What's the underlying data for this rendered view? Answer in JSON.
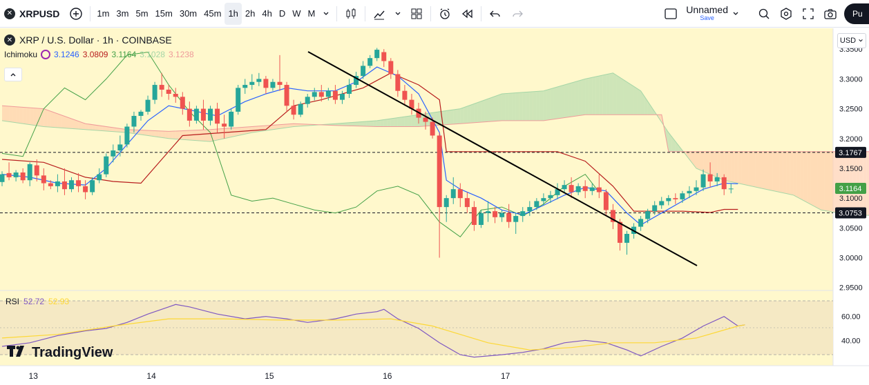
{
  "toolbar": {
    "symbol": "XRPUSD",
    "add_symbol_icon": "plus-circle-icon",
    "timeframes": [
      "1m",
      "3m",
      "5m",
      "15m",
      "30m",
      "45m",
      "1h",
      "2h",
      "4h",
      "D",
      "W",
      "M"
    ],
    "active_timeframe": "1h",
    "layout_name": "Unnamed",
    "save_label": "Save",
    "user_initial": "Pu"
  },
  "legend": {
    "symbol_title": "XRP / U.S. Dollar · 1h · COINBASE",
    "indicator": "Ichimoku",
    "ichimoku_values": [
      {
        "value": "3.1246",
        "color": "#2962ff"
      },
      {
        "value": "3.0809",
        "color": "#b71c1c"
      },
      {
        "value": "3.1164",
        "color": "#43a047"
      },
      {
        "value": "3.1028",
        "color": "#a5d6a7"
      },
      {
        "value": "3.1238",
        "color": "#ef9a9a"
      }
    ],
    "currency": "USD"
  },
  "rsi": {
    "label": "RSI",
    "value": "52.72",
    "ma_value": "52.93",
    "levels": [
      {
        "label": "60.00",
        "value": 60
      },
      {
        "label": "40.00",
        "value": 40
      }
    ]
  },
  "branding": {
    "name": "TradingView"
  },
  "chart_data": {
    "type": "candlestick",
    "title": "XRP / U.S. Dollar · 1h · COINBASE",
    "ylim": [
      2.945,
      3.385
    ],
    "y_ticks": [
      "3.3500",
      "3.3000",
      "3.2500",
      "3.2000",
      "3.1500",
      "3.1000",
      "3.0500",
      "3.0000",
      "2.9500"
    ],
    "x_ticks": [
      {
        "label": "13",
        "t": 4.5
      },
      {
        "label": "14",
        "t": 21.5
      },
      {
        "label": "15",
        "t": 38.5
      },
      {
        "label": "16",
        "t": 55.5
      },
      {
        "label": "17",
        "t": 72.5
      }
    ],
    "price_labels": [
      {
        "label": "3.1767",
        "value": 3.1767,
        "bg": "#131722",
        "dashed": true
      },
      {
        "label": "3.1164",
        "value": 3.1164,
        "bg": "#43a047",
        "dashed": false
      },
      {
        "label": "3.0753",
        "value": 3.0753,
        "bg": "#131722",
        "dashed": true
      }
    ],
    "candles": [
      [
        3.127,
        3.145,
        3.14,
        3.12
      ],
      [
        3.142,
        3.16,
        3.135,
        3.13
      ],
      [
        3.135,
        3.147,
        3.143,
        3.128
      ],
      [
        3.143,
        3.15,
        3.13,
        3.125
      ],
      [
        3.13,
        3.16,
        3.157,
        3.12
      ],
      [
        3.155,
        3.165,
        3.138,
        3.128
      ],
      [
        3.138,
        3.15,
        3.125,
        3.113
      ],
      [
        3.125,
        3.13,
        3.12,
        3.115
      ],
      [
        3.12,
        3.14,
        3.128,
        3.11
      ],
      [
        3.128,
        3.15,
        3.115,
        3.105
      ],
      [
        3.115,
        3.135,
        3.13,
        3.11
      ],
      [
        3.13,
        3.142,
        3.12,
        3.11
      ],
      [
        3.12,
        3.13,
        3.11,
        3.098
      ],
      [
        3.11,
        3.135,
        3.13,
        3.105
      ],
      [
        3.13,
        3.15,
        3.14,
        3.125
      ],
      [
        3.14,
        3.175,
        3.17,
        3.135
      ],
      [
        3.17,
        3.19,
        3.18,
        3.16
      ],
      [
        3.18,
        3.205,
        3.19,
        3.17
      ],
      [
        3.19,
        3.225,
        3.22,
        3.185
      ],
      [
        3.22,
        3.245,
        3.238,
        3.21
      ],
      [
        3.238,
        3.248,
        3.245,
        3.23
      ],
      [
        3.245,
        3.272,
        3.265,
        3.24
      ],
      [
        3.265,
        3.295,
        3.29,
        3.258
      ],
      [
        3.29,
        3.31,
        3.282,
        3.27
      ],
      [
        3.282,
        3.29,
        3.275,
        3.265
      ],
      [
        3.275,
        3.285,
        3.27,
        3.26
      ],
      [
        3.27,
        3.278,
        3.25,
        3.24
      ],
      [
        3.25,
        3.262,
        3.23,
        3.22
      ],
      [
        3.23,
        3.255,
        3.25,
        3.225
      ],
      [
        3.25,
        3.265,
        3.23,
        3.215
      ],
      [
        3.23,
        3.255,
        3.25,
        3.222
      ],
      [
        3.25,
        3.26,
        3.225,
        3.21
      ],
      [
        3.225,
        3.24,
        3.22,
        3.2
      ],
      [
        3.22,
        3.25,
        3.245,
        3.215
      ],
      [
        3.245,
        3.29,
        3.285,
        3.24
      ],
      [
        3.285,
        3.3,
        3.29,
        3.275
      ],
      [
        3.29,
        3.308,
        3.295,
        3.282
      ],
      [
        3.295,
        3.31,
        3.3,
        3.288
      ],
      [
        3.3,
        3.305,
        3.285,
        3.275
      ],
      [
        3.285,
        3.3,
        3.295,
        3.28
      ],
      [
        3.295,
        3.34,
        3.29,
        3.28
      ],
      [
        3.29,
        3.295,
        3.255,
        3.245
      ],
      [
        3.255,
        3.265,
        3.24,
        3.232
      ],
      [
        3.24,
        3.262,
        3.258,
        3.236
      ],
      [
        3.258,
        3.275,
        3.27,
        3.252
      ],
      [
        3.27,
        3.285,
        3.278,
        3.264
      ],
      [
        3.278,
        3.29,
        3.27,
        3.262
      ],
      [
        3.27,
        3.285,
        3.28,
        3.264
      ],
      [
        3.28,
        3.29,
        3.265,
        3.258
      ],
      [
        3.265,
        3.28,
        3.275,
        3.258
      ],
      [
        3.275,
        3.3,
        3.29,
        3.268
      ],
      [
        3.29,
        3.312,
        3.305,
        3.285
      ],
      [
        3.305,
        3.33,
        3.322,
        3.3
      ],
      [
        3.322,
        3.34,
        3.335,
        3.318
      ],
      [
        3.335,
        3.352,
        3.349,
        3.33
      ],
      [
        3.345,
        3.35,
        3.33,
        3.32
      ],
      [
        3.33,
        3.335,
        3.308,
        3.3
      ],
      [
        3.308,
        3.315,
        3.28,
        3.27
      ],
      [
        3.28,
        3.29,
        3.265,
        3.255
      ],
      [
        3.265,
        3.275,
        3.25,
        3.24
      ],
      [
        3.25,
        3.26,
        3.235,
        3.225
      ],
      [
        3.235,
        3.245,
        3.228,
        3.215
      ],
      [
        3.228,
        3.235,
        3.205,
        3.2
      ],
      [
        3.205,
        3.21,
        3.085,
        3.0
      ],
      [
        3.085,
        3.105,
        3.1,
        3.06
      ],
      [
        3.1,
        3.135,
        3.115,
        3.09
      ],
      [
        3.115,
        3.125,
        3.1,
        3.085
      ],
      [
        3.1,
        3.11,
        3.085,
        3.075
      ],
      [
        3.085,
        3.095,
        3.055,
        3.045
      ],
      [
        3.055,
        3.08,
        3.075,
        3.05
      ],
      [
        3.075,
        3.095,
        3.078,
        3.06
      ],
      [
        3.078,
        3.085,
        3.068,
        3.058
      ],
      [
        3.068,
        3.08,
        3.075,
        3.06
      ],
      [
        3.075,
        3.09,
        3.06,
        3.05
      ],
      [
        3.06,
        3.075,
        3.07,
        3.04
      ],
      [
        3.07,
        3.085,
        3.078,
        3.06
      ],
      [
        3.078,
        3.095,
        3.085,
        3.07
      ],
      [
        3.085,
        3.1,
        3.095,
        3.08
      ],
      [
        3.095,
        3.108,
        3.1,
        3.088
      ],
      [
        3.1,
        3.112,
        3.105,
        3.092
      ],
      [
        3.105,
        3.125,
        3.115,
        3.098
      ],
      [
        3.115,
        3.13,
        3.122,
        3.108
      ],
      [
        3.122,
        3.135,
        3.11,
        3.1
      ],
      [
        3.11,
        3.125,
        3.12,
        3.105
      ],
      [
        3.12,
        3.13,
        3.112,
        3.1
      ],
      [
        3.112,
        3.125,
        3.118,
        3.105
      ],
      [
        3.118,
        3.14,
        3.11,
        3.1
      ],
      [
        3.11,
        3.115,
        3.08,
        3.07
      ],
      [
        3.08,
        3.09,
        3.06,
        3.048
      ],
      [
        3.06,
        3.065,
        3.025,
        3.012
      ],
      [
        3.025,
        3.045,
        3.04,
        3.005
      ],
      [
        3.04,
        3.058,
        3.052,
        3.032
      ],
      [
        3.052,
        3.07,
        3.065,
        3.045
      ],
      [
        3.065,
        3.082,
        3.078,
        3.058
      ],
      [
        3.078,
        3.095,
        3.088,
        3.072
      ],
      [
        3.088,
        3.102,
        3.095,
        3.082
      ],
      [
        3.095,
        3.105,
        3.1,
        3.088
      ],
      [
        3.1,
        3.108,
        3.098,
        3.09
      ],
      [
        3.098,
        3.112,
        3.108,
        3.092
      ],
      [
        3.108,
        3.12,
        3.112,
        3.1
      ],
      [
        3.112,
        3.13,
        3.118,
        3.105
      ],
      [
        3.118,
        3.148,
        3.14,
        3.112
      ],
      [
        3.14,
        3.16,
        3.128,
        3.118
      ],
      [
        3.128,
        3.142,
        3.135,
        3.12
      ],
      [
        3.135,
        3.14,
        3.115,
        3.105
      ],
      [
        3.115,
        3.125,
        3.116,
        3.108
      ]
    ],
    "tenkan": [
      [
        0,
        3.14
      ],
      [
        4,
        3.135
      ],
      [
        8,
        3.125
      ],
      [
        12,
        3.122
      ],
      [
        15,
        3.15
      ],
      [
        18,
        3.19
      ],
      [
        21,
        3.23
      ],
      [
        24,
        3.255
      ],
      [
        27,
        3.248
      ],
      [
        31,
        3.238
      ],
      [
        35,
        3.262
      ],
      [
        38,
        3.275
      ],
      [
        41,
        3.285
      ],
      [
        44,
        3.28
      ],
      [
        48,
        3.28
      ],
      [
        51,
        3.295
      ],
      [
        54,
        3.32
      ],
      [
        57,
        3.305
      ],
      [
        60,
        3.275
      ],
      [
        63,
        3.21
      ],
      [
        64,
        3.13
      ],
      [
        66,
        3.115
      ],
      [
        69,
        3.1
      ],
      [
        72,
        3.08
      ],
      [
        75,
        3.072
      ],
      [
        78,
        3.088
      ],
      [
        81,
        3.105
      ],
      [
        84,
        3.118
      ],
      [
        87,
        3.112
      ],
      [
        90,
        3.075
      ],
      [
        92,
        3.055
      ],
      [
        95,
        3.075
      ],
      [
        98,
        3.095
      ],
      [
        101,
        3.115
      ],
      [
        104,
        3.125
      ],
      [
        106,
        3.124
      ]
    ],
    "kijun": [
      [
        0,
        3.165
      ],
      [
        6,
        3.16
      ],
      [
        12,
        3.135
      ],
      [
        16,
        3.128
      ],
      [
        20,
        3.125
      ],
      [
        26,
        3.205
      ],
      [
        32,
        3.21
      ],
      [
        38,
        3.215
      ],
      [
        42,
        3.255
      ],
      [
        46,
        3.265
      ],
      [
        52,
        3.285
      ],
      [
        56,
        3.31
      ],
      [
        60,
        3.29
      ],
      [
        63,
        3.265
      ],
      [
        64,
        3.178
      ],
      [
        70,
        3.178
      ],
      [
        80,
        3.178
      ],
      [
        84,
        3.162
      ],
      [
        88,
        3.12
      ],
      [
        91,
        3.078
      ],
      [
        98,
        3.078
      ],
      [
        102,
        3.076
      ],
      [
        104,
        3.081
      ],
      [
        106,
        3.081
      ]
    ],
    "chikou": [
      [
        0,
        3.175
      ],
      [
        3,
        3.17
      ],
      [
        6,
        3.25
      ],
      [
        9,
        3.285
      ],
      [
        12,
        3.265
      ],
      [
        15,
        3.3
      ],
      [
        18,
        3.34
      ],
      [
        21,
        3.345
      ],
      [
        24,
        3.29
      ],
      [
        27,
        3.245
      ],
      [
        30,
        3.21
      ],
      [
        33,
        3.105
      ],
      [
        36,
        3.095
      ],
      [
        39,
        3.1
      ],
      [
        42,
        3.09
      ],
      [
        45,
        3.08
      ],
      [
        48,
        3.075
      ],
      [
        51,
        3.085
      ],
      [
        54,
        3.112
      ],
      [
        57,
        3.12
      ],
      [
        60,
        3.105
      ],
      [
        63,
        3.06
      ],
      [
        66,
        3.035
      ],
      [
        69,
        3.08
      ],
      [
        72,
        3.085
      ],
      [
        75,
        3.07
      ],
      [
        78,
        3.09
      ],
      [
        81,
        3.12
      ],
      [
        84,
        3.14
      ],
      [
        86,
        3.11
      ]
    ],
    "span_a": [
      [
        0,
        3.23
      ],
      [
        6,
        3.22
      ],
      [
        12,
        3.215
      ],
      [
        18,
        3.21
      ],
      [
        24,
        3.2
      ],
      [
        30,
        3.195
      ],
      [
        36,
        3.21
      ],
      [
        42,
        3.22
      ],
      [
        48,
        3.225
      ],
      [
        54,
        3.23
      ],
      [
        60,
        3.24
      ],
      [
        66,
        3.25
      ],
      [
        72,
        3.275
      ],
      [
        78,
        3.28
      ],
      [
        84,
        3.3
      ],
      [
        88,
        3.31
      ],
      [
        92,
        3.28
      ],
      [
        96,
        3.21
      ],
      [
        100,
        3.15
      ],
      [
        104,
        3.13
      ],
      [
        110,
        3.115
      ],
      [
        114,
        3.105
      ],
      [
        118,
        3.08
      ],
      [
        122,
        3.072
      ],
      [
        128,
        3.07
      ],
      [
        134,
        3.08
      ],
      [
        138,
        3.1
      ]
    ],
    "span_b": [
      [
        0,
        3.255
      ],
      [
        6,
        3.25
      ],
      [
        12,
        3.225
      ],
      [
        18,
        3.215
      ],
      [
        24,
        3.212
      ],
      [
        30,
        3.215
      ],
      [
        36,
        3.22
      ],
      [
        42,
        3.225
      ],
      [
        48,
        3.222
      ],
      [
        54,
        3.22
      ],
      [
        60,
        3.22
      ],
      [
        66,
        3.225
      ],
      [
        72,
        3.23
      ],
      [
        78,
        3.23
      ],
      [
        84,
        3.24
      ],
      [
        90,
        3.24
      ],
      [
        95,
        3.24
      ],
      [
        96,
        3.178
      ],
      [
        104,
        3.178
      ],
      [
        112,
        3.178
      ],
      [
        120,
        3.178
      ],
      [
        128,
        3.178
      ],
      [
        134,
        3.175
      ],
      [
        138,
        3.14
      ]
    ],
    "rsi": [
      [
        0,
        35
      ],
      [
        4,
        38
      ],
      [
        8,
        44
      ],
      [
        12,
        48
      ],
      [
        15,
        50
      ],
      [
        18,
        55
      ],
      [
        21,
        62
      ],
      [
        24,
        68
      ],
      [
        25,
        70
      ],
      [
        27,
        68
      ],
      [
        31,
        62
      ],
      [
        35,
        58
      ],
      [
        38,
        60
      ],
      [
        41,
        58
      ],
      [
        44,
        55
      ],
      [
        48,
        58
      ],
      [
        51,
        62
      ],
      [
        54,
        64
      ],
      [
        55,
        66
      ],
      [
        57,
        58
      ],
      [
        60,
        50
      ],
      [
        63,
        38
      ],
      [
        66,
        28
      ],
      [
        68,
        26
      ],
      [
        72,
        28
      ],
      [
        75,
        30
      ],
      [
        78,
        33
      ],
      [
        81,
        38
      ],
      [
        84,
        40
      ],
      [
        87,
        38
      ],
      [
        90,
        32
      ],
      [
        92,
        27
      ],
      [
        95,
        35
      ],
      [
        98,
        42
      ],
      [
        101,
        52
      ],
      [
        104,
        60
      ],
      [
        106,
        52
      ],
      [
        107,
        53
      ]
    ],
    "rsi_ma": [
      [
        0,
        42
      ],
      [
        8,
        45
      ],
      [
        16,
        52
      ],
      [
        24,
        58
      ],
      [
        32,
        58
      ],
      [
        40,
        57
      ],
      [
        48,
        57
      ],
      [
        56,
        58
      ],
      [
        62,
        52
      ],
      [
        66,
        45
      ],
      [
        70,
        38
      ],
      [
        76,
        32
      ],
      [
        82,
        34
      ],
      [
        88,
        38
      ],
      [
        94,
        38
      ],
      [
        100,
        42
      ],
      [
        106,
        52
      ],
      [
        107,
        53
      ]
    ]
  }
}
